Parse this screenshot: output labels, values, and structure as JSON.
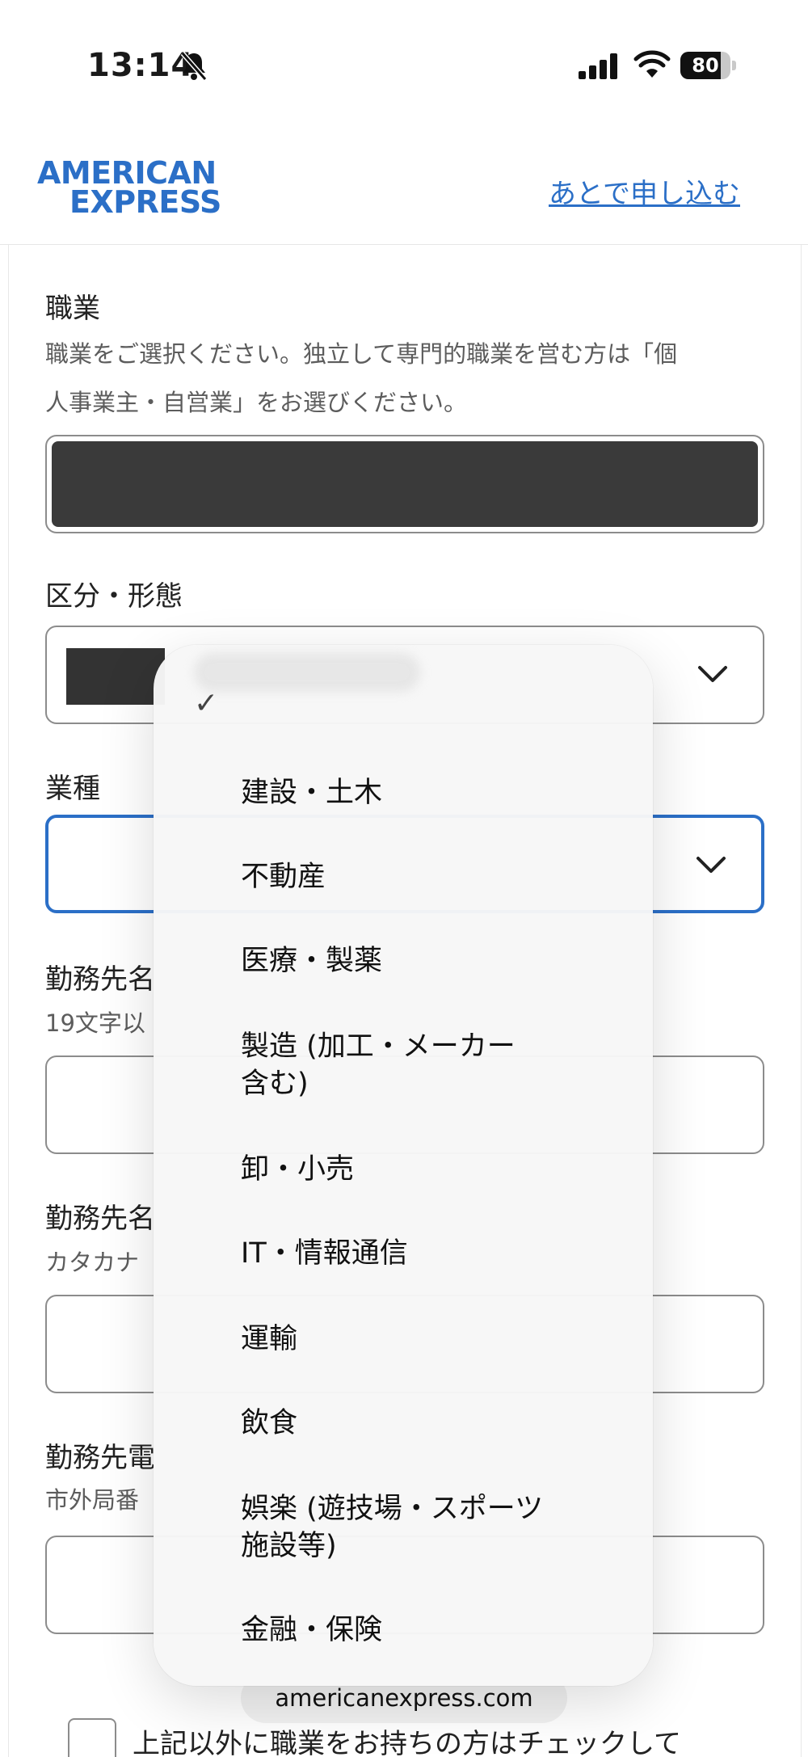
{
  "status_bar": {
    "time": "13:14",
    "battery": "80",
    "battery_level": 0.8
  },
  "header": {
    "logo_line1": "AMERICAN",
    "logo_line2": "EXPRESS",
    "apply_later": "あとで申し込む"
  },
  "form": {
    "occupation": {
      "label": "職業",
      "help_line1": "職業をご選択ください。独立して専門的職業を営む方は「個",
      "help_line2": "人事業主・自営業」をお選びください。"
    },
    "category": {
      "label": "区分・形態"
    },
    "industry": {
      "label": "業種"
    },
    "employer_name": {
      "label": "勤務先名",
      "help": "19文字以"
    },
    "employer_kana": {
      "label": "勤務先名",
      "help": "カタカナ"
    },
    "employer_phone": {
      "label": "勤務先電",
      "help": "市外局番"
    },
    "other_occupation_checkbox": {
      "label": "上記以外に職業をお持ちの方はチェックして"
    }
  },
  "dropdown": {
    "checked": "✓",
    "options": [
      {
        "text": "建設・土木"
      },
      {
        "text": "不動産"
      },
      {
        "text": "医療・製薬"
      },
      {
        "line1": "製造 (加工・メーカー",
        "line2": "含む)"
      },
      {
        "text": "卸・小売"
      },
      {
        "text": "IT・情報通信"
      },
      {
        "text": "運輸"
      },
      {
        "text": "飲食"
      },
      {
        "line1": "娯楽 (遊技場・スポーツ",
        "line2": "施設等)"
      },
      {
        "text": "金融・保険"
      }
    ]
  },
  "url_bar": {
    "domain": "americanexpress.com"
  },
  "colors": {
    "brand_blue": "#2b6fc7",
    "focus_blue": "#2b6fc7"
  }
}
